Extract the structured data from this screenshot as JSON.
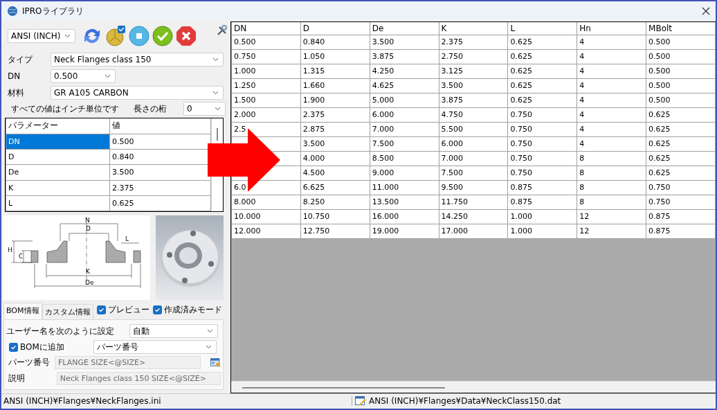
{
  "window": {
    "title": "IPROライブラリ"
  },
  "toolbar": {
    "standard": "ANSI (INCH)"
  },
  "form": {
    "fields": [
      {
        "label": "タイプ",
        "value": "Neck Flanges class 150",
        "kind": "wide"
      },
      {
        "label": "DN",
        "value": "0.500",
        "kind": "narrow"
      },
      {
        "label": "材料",
        "value": "GR A105 CARBON",
        "kind": "wide"
      }
    ],
    "units_note": "すべての値はインチ単位です",
    "digits_label": "長さの桁",
    "digits_value": "0"
  },
  "parameters": {
    "columns": [
      "パラメーター",
      "値"
    ],
    "rows": [
      {
        "name": "DN",
        "value": "0.500",
        "selected": true
      },
      {
        "name": "D",
        "value": "0.840",
        "selected": false
      },
      {
        "name": "De",
        "value": "3.500",
        "selected": false
      },
      {
        "name": "K",
        "value": "2.375",
        "selected": false
      },
      {
        "name": "L",
        "value": "0.625",
        "selected": false
      }
    ]
  },
  "diagram_labels": [
    "N",
    "D",
    "H",
    "C",
    "L",
    "K",
    "De"
  ],
  "options": [
    {
      "label": "プレビュー",
      "checked": true
    },
    {
      "label": "作成済みモード",
      "checked": true
    }
  ],
  "tabs": [
    {
      "label": "BOM情報",
      "selected": true
    },
    {
      "label": "カスタム情報",
      "selected": false
    }
  ],
  "bom": {
    "user_name_label": "ユーザー名を次のように設定",
    "user_name_value": "自動",
    "add_to_bom": {
      "label": "BOMに追加",
      "checked": true
    },
    "bom_field": "パーツ番号",
    "fields": [
      {
        "label": "パーツ番号",
        "value": "FLANGE SIZE<@SIZE>",
        "disabled": true
      },
      {
        "label": "説明",
        "value": "Neck Flanges class 150 SIZE<@SIZE>",
        "disabled": true
      }
    ]
  },
  "data_table": {
    "columns": [
      "DN",
      "D",
      "De",
      "K",
      "L",
      "Hn",
      "MBolt"
    ],
    "rows": [
      [
        "0.500",
        "0.840",
        "3.500",
        "2.375",
        "0.625",
        "4",
        "0.500"
      ],
      [
        "0.750",
        "1.050",
        "3.875",
        "2.750",
        "0.625",
        "4",
        "0.500"
      ],
      [
        "1.000",
        "1.315",
        "4.250",
        "3.125",
        "0.625",
        "4",
        "0.500"
      ],
      [
        "1.250",
        "1.660",
        "4.625",
        "3.500",
        "0.625",
        "4",
        "0.500"
      ],
      [
        "1.500",
        "1.900",
        "5.000",
        "3.875",
        "0.625",
        "4",
        "0.500"
      ],
      [
        "2.000",
        "2.375",
        "6.000",
        "4.750",
        "0.750",
        "4",
        "0.625"
      ],
      [
        "2.5",
        "2.875",
        "7.000",
        "5.500",
        "0.750",
        "4",
        "0.625"
      ],
      [
        null,
        "3.500",
        "7.500",
        "6.000",
        "0.750",
        "4",
        "0.625"
      ],
      [
        null,
        "4.000",
        "8.500",
        "7.000",
        "0.750",
        "8",
        "0.625"
      ],
      [
        null,
        "4.500",
        "9.000",
        "7.500",
        "0.750",
        "8",
        "0.625"
      ],
      [
        "6.0",
        "6.625",
        "11.000",
        "9.500",
        "0.875",
        "8",
        "0.750"
      ],
      [
        "8.000",
        "8.250",
        "13.500",
        "11.750",
        "0.875",
        "8",
        "0.750"
      ],
      [
        "10.000",
        "10.750",
        "16.000",
        "14.250",
        "1.000",
        "12",
        "0.875"
      ],
      [
        "12.000",
        "12.750",
        "19.000",
        "17.000",
        "1.000",
        "12",
        "0.875"
      ]
    ]
  },
  "status_bar": {
    "left": "ANSI (INCH)¥Flanges¥NeckFlanges.ini",
    "right": "ANSI (INCH)¥Flanges¥Data¥NeckClass150.dat"
  }
}
